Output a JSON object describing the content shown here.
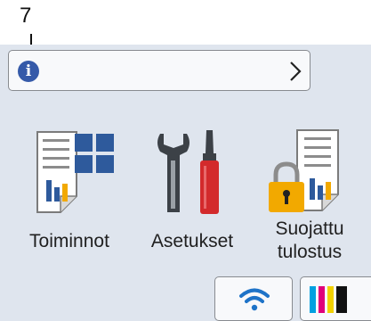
{
  "callout": {
    "number": "7"
  },
  "info_bar": {
    "message": ""
  },
  "apps": [
    {
      "label": "Toiminnot"
    },
    {
      "label": "Asetukset"
    },
    {
      "label_line1": "Suojattu",
      "label_line2": "tulostus"
    }
  ],
  "status": {
    "wifi_icon": "wifi-icon",
    "ink_colors": [
      "#00a0e0",
      "#e0007a",
      "#f2d100",
      "#111111"
    ]
  },
  "colors": {
    "screen_bg": "#dfe5ee",
    "info_blue": "#355aa9",
    "wrench_gray": "#3c4147",
    "screwdriver_red": "#d32a2c",
    "lock_gold": "#f2a900"
  }
}
